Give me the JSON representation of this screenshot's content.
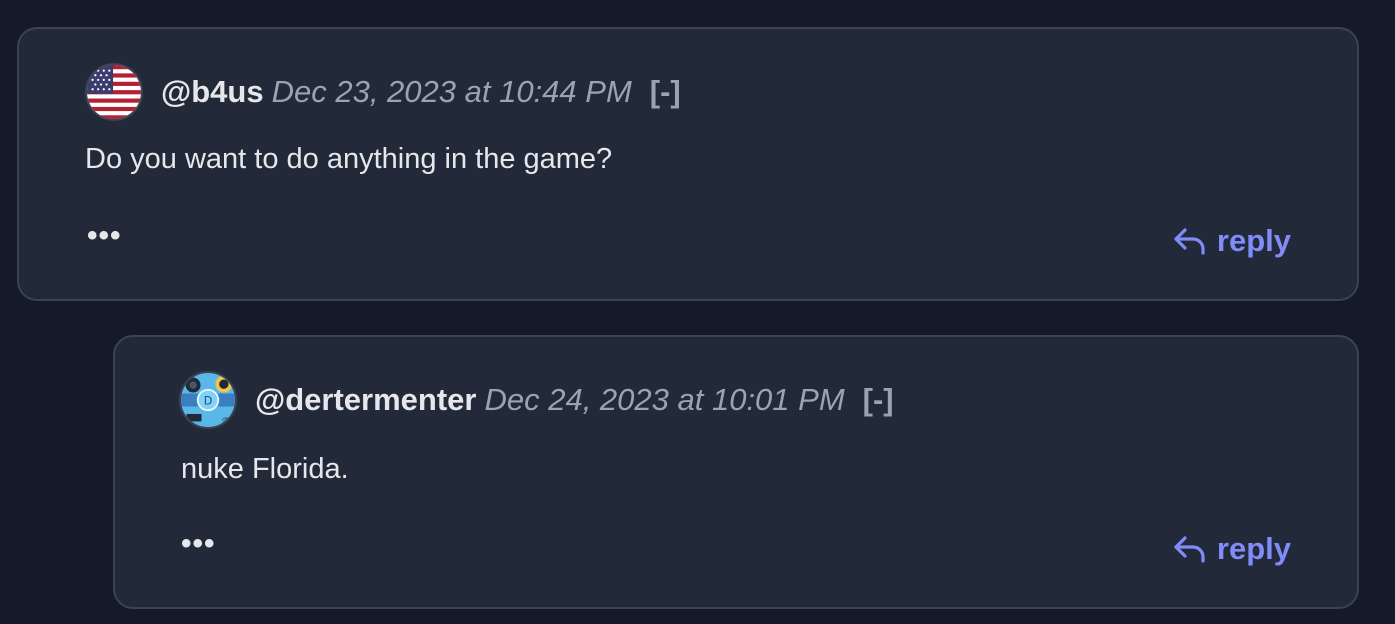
{
  "comments": [
    {
      "username": "@b4us",
      "timestamp": "Dec 23, 2023 at 10:44 PM",
      "collapse_label": "[-]",
      "body": "Do you want to do anything in the game?",
      "more_label": "•••",
      "reply_label": "reply",
      "avatar_icon": "us-flag-avatar"
    },
    {
      "username": "@dertermenter",
      "timestamp": "Dec 24, 2023 at 10:01 PM",
      "collapse_label": "[-]",
      "body": "nuke Florida.",
      "more_label": "•••",
      "reply_label": "reply",
      "avatar_icon": "blue-abstract-avatar"
    }
  ],
  "colors": {
    "background": "#141a29",
    "card": "#222a3a",
    "border": "#3a4253",
    "accent": "#818cf8",
    "muted": "#9ca3af",
    "text": "#e5e7eb"
  }
}
